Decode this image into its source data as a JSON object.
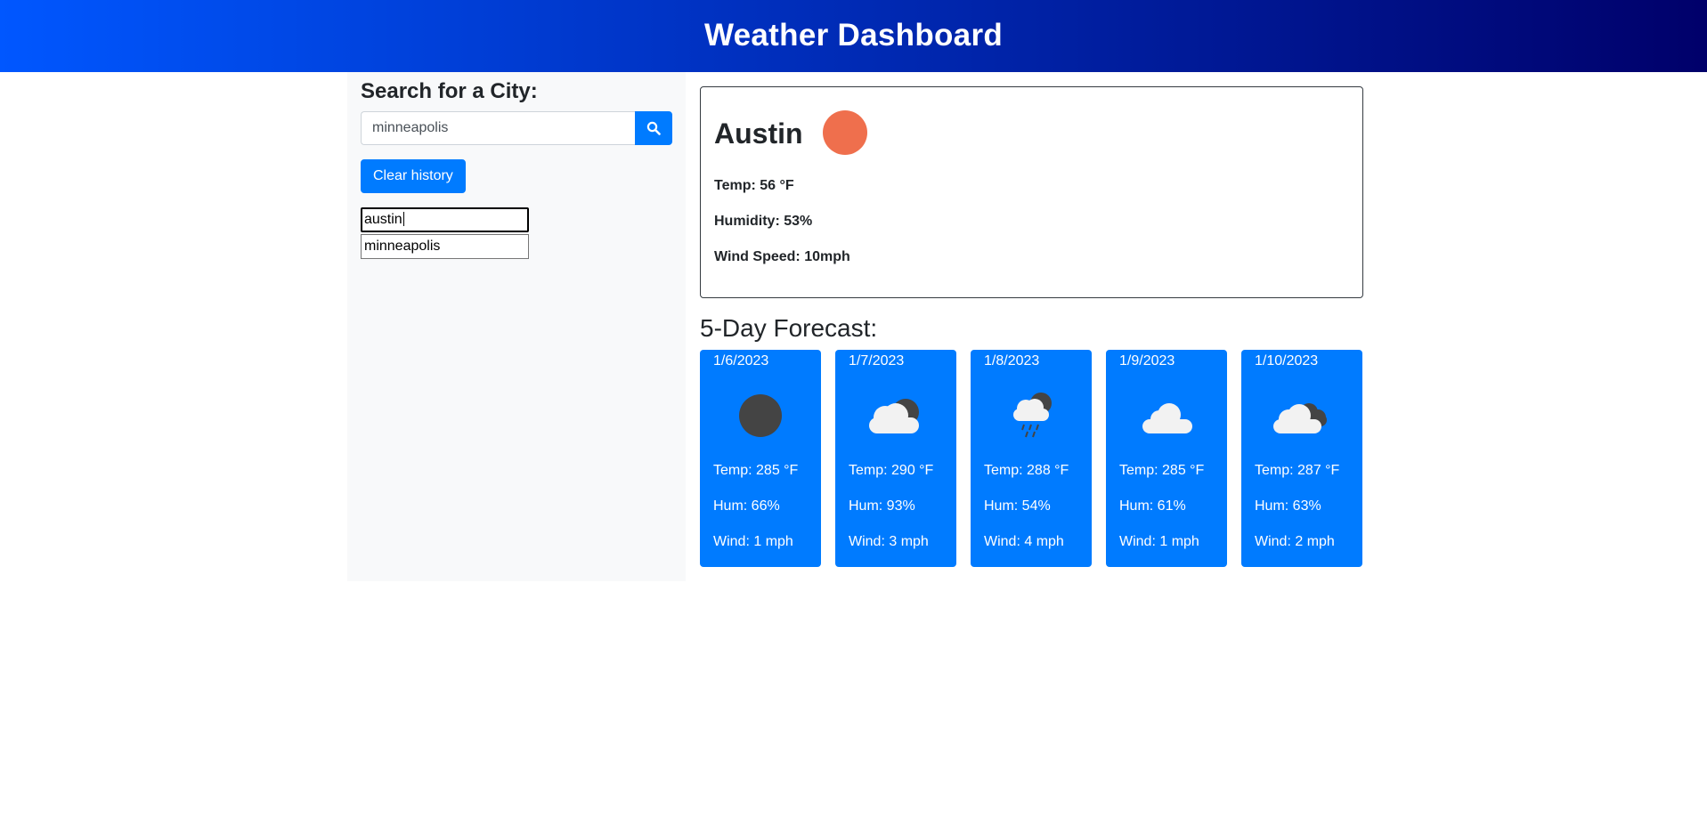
{
  "header": {
    "title": "Weather Dashboard"
  },
  "sidebar": {
    "heading": "Search for a City:",
    "search": {
      "value": "minneapolis",
      "button_icon": "search-icon"
    },
    "clear_label": "Clear history",
    "history": [
      "austin",
      "minneapolis"
    ]
  },
  "current": {
    "city": "Austin",
    "icon": "sun-icon",
    "icon_color": "#ef6f4d",
    "temp": "Temp: 56 °F",
    "humidity": "Humidity: 53%",
    "wind": "Wind Speed: 10mph"
  },
  "forecast": {
    "title": "5-Day Forecast:",
    "card_color": "#007bff",
    "days": [
      {
        "date": "1/6/2023",
        "icon": "night-clear-icon",
        "temp": "Temp: 285 °F",
        "hum": "Hum: 66%",
        "wind": "Wind: 1 mph"
      },
      {
        "date": "1/7/2023",
        "icon": "night-partly-cloudy-icon",
        "temp": "Temp: 290 °F",
        "hum": "Hum: 93%",
        "wind": "Wind: 3 mph"
      },
      {
        "date": "1/8/2023",
        "icon": "night-rain-icon",
        "temp": "Temp: 288 °F",
        "hum": "Hum: 54%",
        "wind": "Wind: 4 mph"
      },
      {
        "date": "1/9/2023",
        "icon": "cloud-icon",
        "temp": "Temp: 285 °F",
        "hum": "Hum: 61%",
        "wind": "Wind: 1 mph"
      },
      {
        "date": "1/10/2023",
        "icon": "broken-clouds-icon",
        "temp": "Temp: 287 °F",
        "hum": "Hum: 63%",
        "wind": "Wind: 2 mph"
      }
    ]
  }
}
